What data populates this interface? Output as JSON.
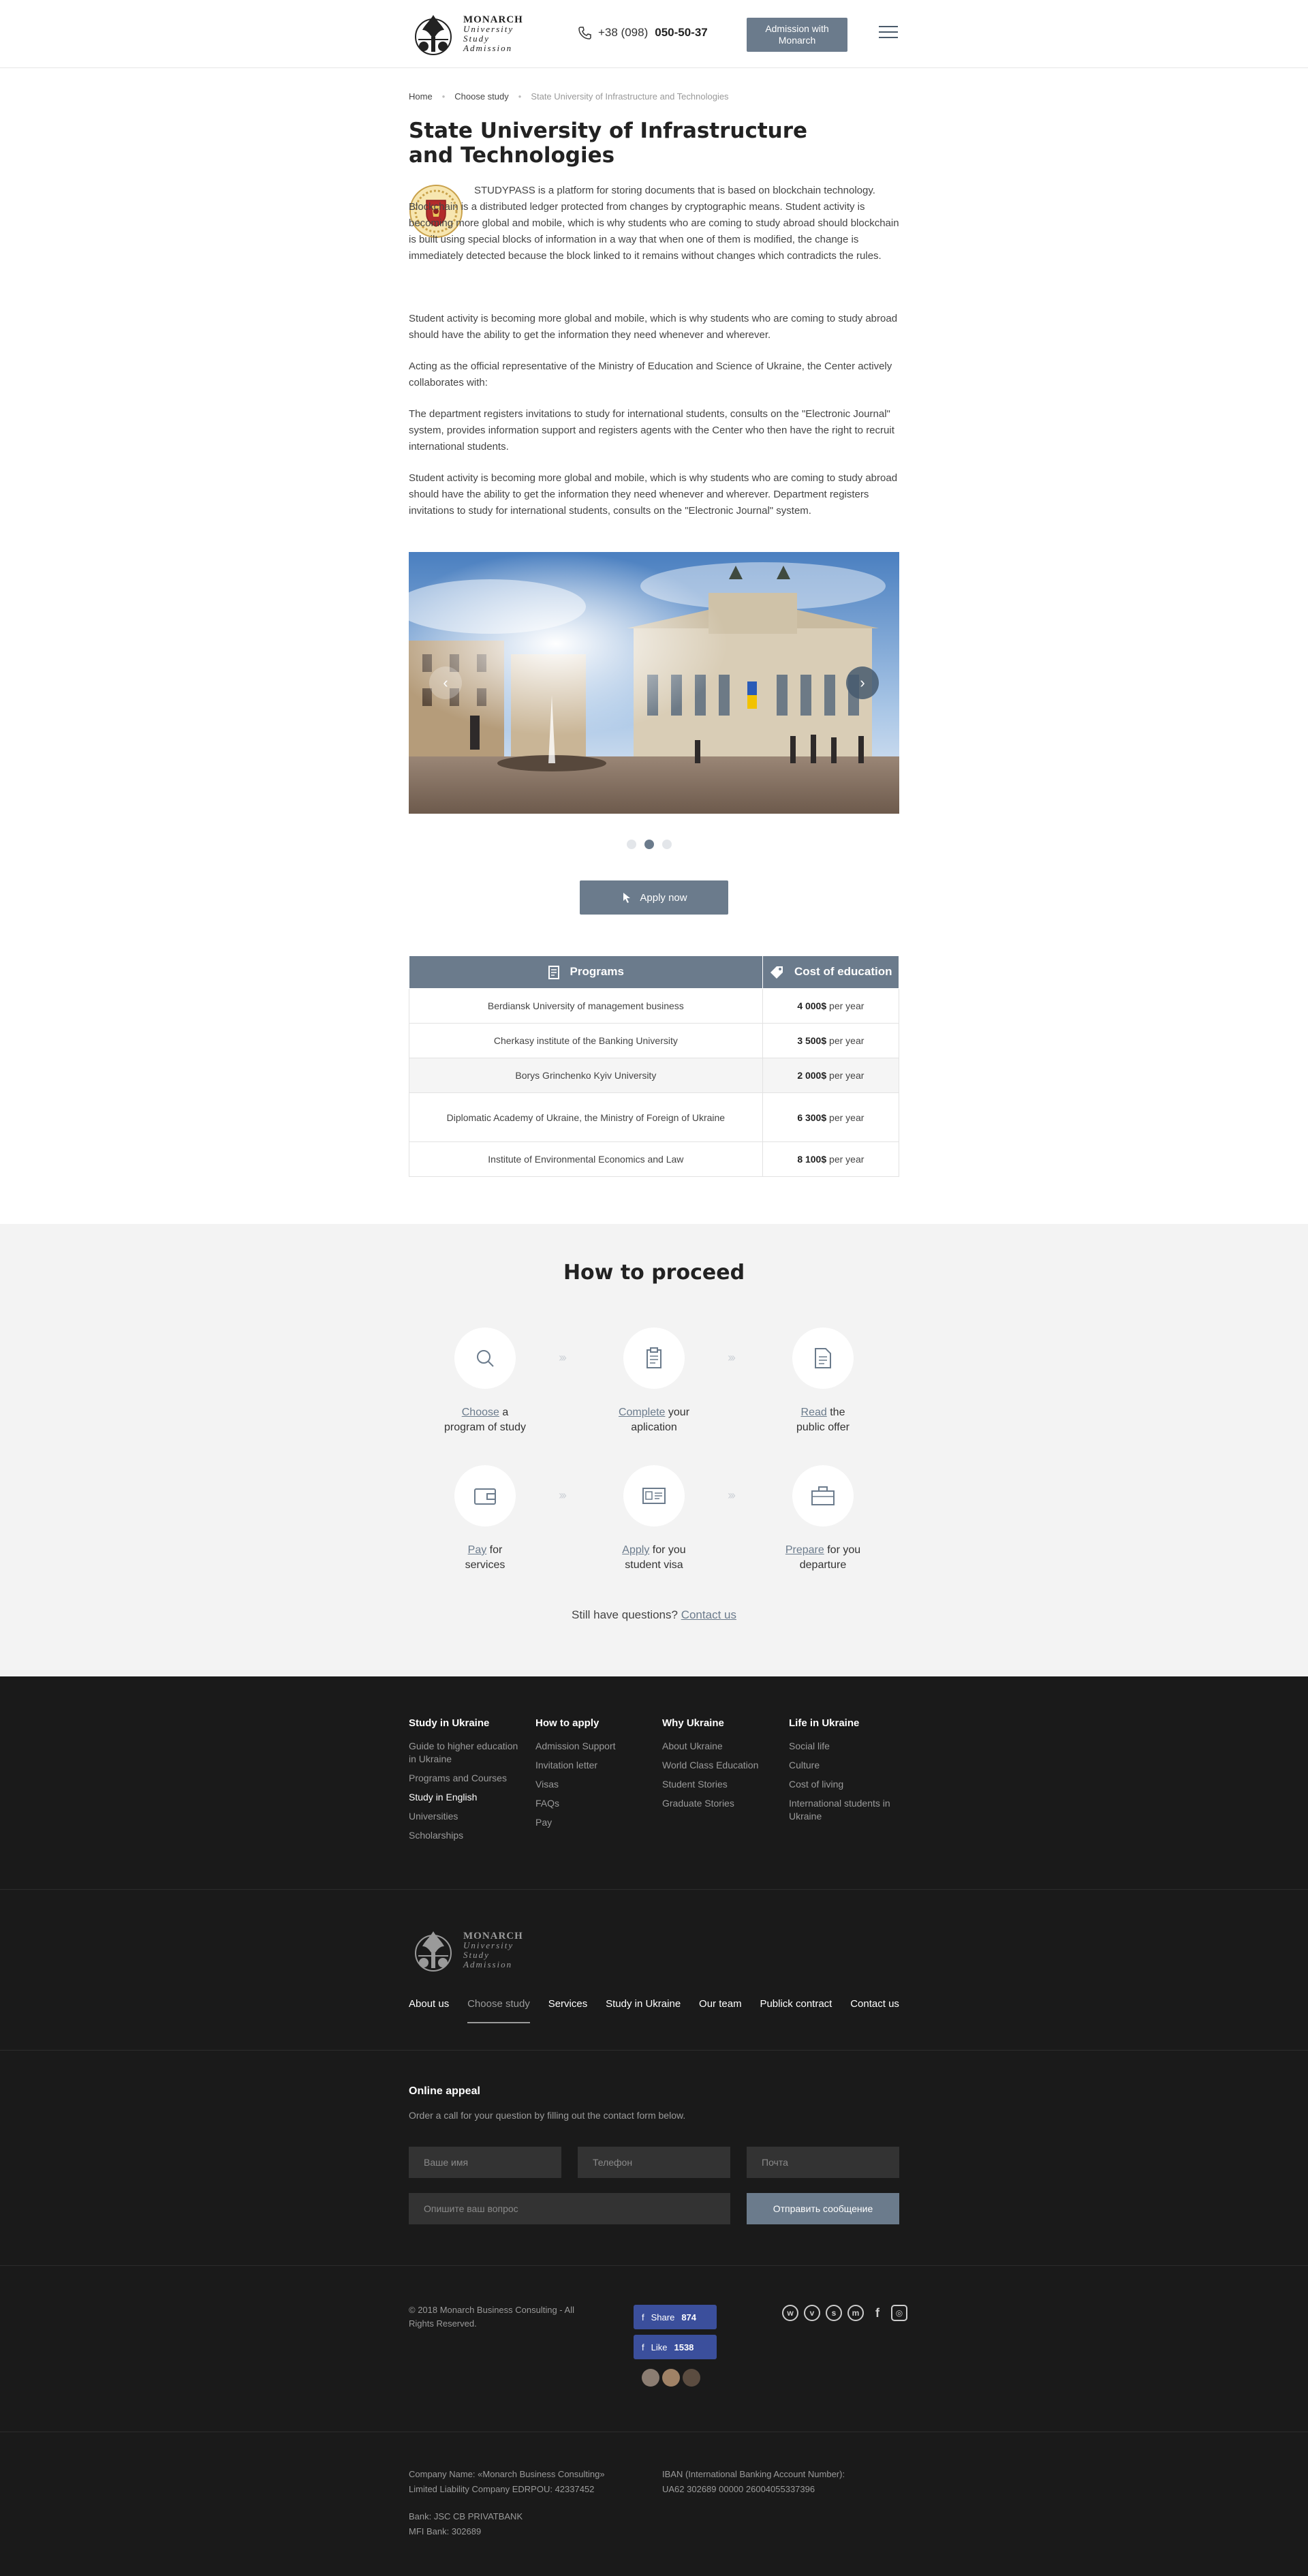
{
  "header": {
    "logo_lines": [
      "MONARCH",
      "University",
      "Study",
      "Admission"
    ],
    "phone_prefix": "+38 (098)",
    "phone_number": "050-50-37",
    "admission_button": "Admission with Monarch"
  },
  "breadcrumb": {
    "home": "Home",
    "choose": "Choose study",
    "current": "State University of Infrastructure and Technologies"
  },
  "page": {
    "title": "State University of Infrastructure and Technologies",
    "intro": "STUDYPASS is a platform for storing documents that is based on blockchain technology. Blockchain is a distributed ledger protected from changes by cryptographic means. Student activity is becoming more global and mobile, which is why students who are coming to study abroad should blockchain is built using special blocks of information in a way that when one of them is modified, the change is immediately detected because the block linked to it remains without changes which contradicts the rules.",
    "p1": "Student activity is becoming more global and mobile, which is why students who are coming to study abroad should have the ability to get the information they need whenever and wherever.",
    "p2": "Acting as the official representative of the Ministry of Education and Science of Ukraine, the Center actively collaborates with:",
    "p3": "The department registers invitations to study for international students, consults on the \"Electronic Journal\" system, provides information support and registers agents with the Center who then have the right to recruit international students.",
    "p4": "Student activity is becoming more global and mobile, which is why students who are coming to study abroad should have the ability to get the information they need whenever and wherever. Department registers invitations to study for international students, consults on the \"Electronic Journal\" system.",
    "apply_button": "Apply now"
  },
  "table": {
    "col_programs": "Programs",
    "col_cost": "Cost of education",
    "per_year": "per year",
    "rows": [
      {
        "program": "Berdiansk University of management business",
        "cost": "4 000$"
      },
      {
        "program": "Cherkasy institute of the Banking University",
        "cost": "3 500$"
      },
      {
        "program": "Borys Grinchenko Kyiv University",
        "cost": "2 000$"
      },
      {
        "program": "Diplomatic Academy of Ukraine, the Ministry of Foreign of Ukraine",
        "cost": "6 300$"
      },
      {
        "program": "Institute of Environmental Economics and Law",
        "cost": "8 100$"
      }
    ]
  },
  "proceed": {
    "title": "How to proceed",
    "steps": [
      {
        "link": "Choose",
        "rest": "a",
        "line2": "program of study",
        "icon": "search-icon"
      },
      {
        "link": "Complete",
        "rest": "your",
        "line2": "aplication",
        "icon": "clipboard-icon"
      },
      {
        "link": "Read",
        "rest": "the",
        "line2": "public offer",
        "icon": "document-icon"
      },
      {
        "link": "Pay",
        "rest": "for",
        "line2": "services",
        "icon": "wallet-icon"
      },
      {
        "link": "Apply",
        "rest": "for you",
        "line2": "student visa",
        "icon": "id-card-icon"
      },
      {
        "link": "Prepare",
        "rest": "for you",
        "line2": "departure",
        "icon": "briefcase-icon"
      }
    ],
    "questions_text": "Still have questions?",
    "contact_link": "Contact us"
  },
  "footer": {
    "columns": [
      {
        "title": "Study in Ukraine",
        "items": [
          "Guide to higher education in Ukraine",
          "Programs and Courses",
          "Study in English",
          "Universities",
          "Scholarships"
        ]
      },
      {
        "title": "How to apply",
        "items": [
          "Admission Support",
          "Invitation letter",
          "Visas",
          "FAQs",
          "Pay"
        ]
      },
      {
        "title": "Why Ukraine",
        "items": [
          "About Ukraine",
          "World Class Education",
          "Student Stories",
          "Graduate Stories"
        ]
      },
      {
        "title": "Life in Ukraine",
        "items": [
          "Social life",
          "Culture",
          "Cost of living",
          "International students in Ukraine"
        ]
      }
    ],
    "nav": [
      "About us",
      "Choose study",
      "Services",
      "Study in Ukraine",
      "Our team",
      "Publick contract",
      "Contact us"
    ],
    "appeal_title": "Online appeal",
    "appeal_subtitle": "Order a call for your question by filling out the contact form below.",
    "name_placeholder": "Ваше имя",
    "phone_placeholder": "Телефон",
    "email_placeholder": "Почта",
    "question_placeholder": "Опишите ваш вопрос",
    "submit": "Отправить сообщение",
    "copyright": "© 2018 Monarch Business Consulting - All Rights Reserved.",
    "share_label": "Share",
    "share_count": "874",
    "like_label": "Like",
    "like_count": "1538",
    "company_line1": "Company Name: «Monarch Business Consulting»",
    "company_line2": "Limited Liability Company EDRPOU: 42337452",
    "bank_line1": "Bank: JSC CB PRIVATBANK",
    "bank_line2": "MFI Bank: 302689",
    "iban_line1": "IBAN (International Banking Account Number):",
    "iban_line2": "UA62 302689 00000 26004055337396"
  },
  "colors": {
    "accent": "#6b7b8c",
    "footer_bg": "#1a1a1a",
    "proceed_bg": "#f3f3f3",
    "facebook": "#3b4f9c"
  }
}
